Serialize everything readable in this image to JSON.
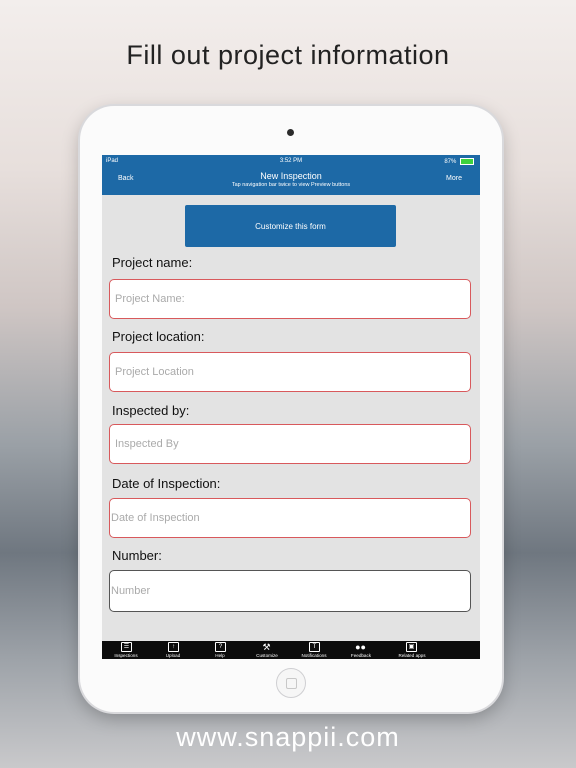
{
  "headline": "Fill out project information",
  "footer_url": "www.snappii.com",
  "status_bar": {
    "device": "iPad",
    "time": "3:52 PM",
    "battery": "87%"
  },
  "nav": {
    "back_label": "Back",
    "title": "New Inspection",
    "subtitle": "Tap navigation bar twice to view Preview buttons",
    "more_label": "More"
  },
  "customize_button": "Customize this form",
  "form": {
    "fields": [
      {
        "label": "Project name:",
        "placeholder": "Project Name:"
      },
      {
        "label": "Project location:",
        "placeholder": "Project Location"
      },
      {
        "label": "Inspected by:",
        "placeholder": "Inspected By"
      },
      {
        "label": "Date of Inspection:",
        "placeholder": "Date of Inspection"
      },
      {
        "label": "Number:",
        "placeholder": "Number"
      }
    ]
  },
  "tabs": [
    {
      "label": "Inspections",
      "icon": "inspections-icon"
    },
    {
      "label": "Upload",
      "icon": "upload-icon"
    },
    {
      "label": "Help",
      "icon": "help-icon"
    },
    {
      "label": "Customize",
      "icon": "tools-icon"
    },
    {
      "label": "Notifications",
      "icon": "notifications-icon"
    },
    {
      "label": "Feedback",
      "icon": "feedback-icon"
    },
    {
      "label": "Related apps",
      "icon": "related-apps-icon"
    }
  ]
}
